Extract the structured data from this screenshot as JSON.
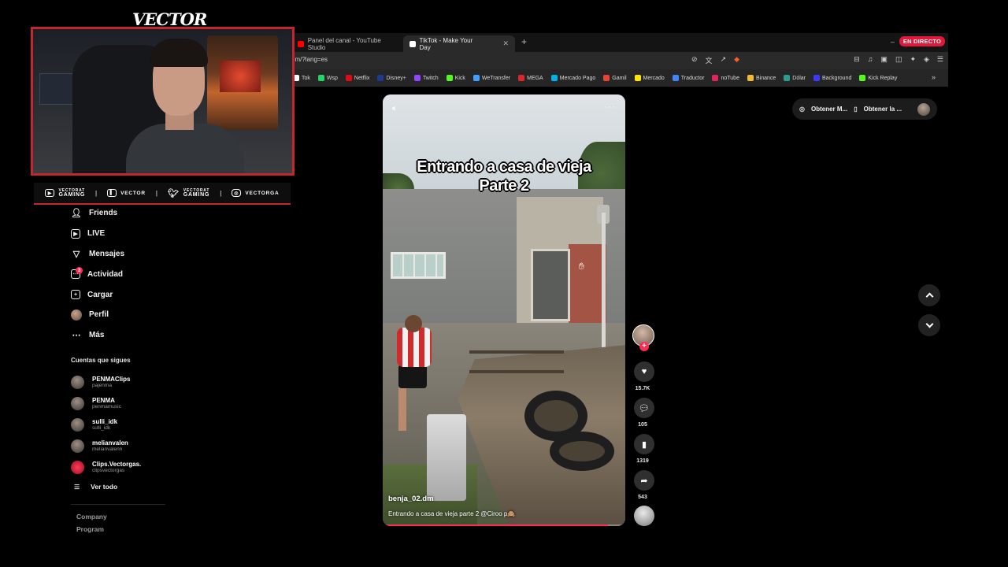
{
  "brand": "VECTOR",
  "browser": {
    "tabs": [
      {
        "label": "Panel del canal - YouTube Studio",
        "color": "#ff0000"
      },
      {
        "label": "TikTok - Make Your Day",
        "color": "#ffffff",
        "active": true
      }
    ],
    "new_tab": "+",
    "live_badge": "EN DIRECTO",
    "minimize": "–",
    "url": "om/?lang=es",
    "bookmarks": [
      {
        "label": "Tok",
        "color": "#ffffff"
      },
      {
        "label": "Wsp",
        "color": "#25d366"
      },
      {
        "label": "Netflix",
        "color": "#e50914"
      },
      {
        "label": "Disney+",
        "color": "#1f3a93"
      },
      {
        "label": "Twitch",
        "color": "#9146ff"
      },
      {
        "label": "Kick",
        "color": "#53fc18"
      },
      {
        "label": "WeTransfer",
        "color": "#409fff"
      },
      {
        "label": "MEGA",
        "color": "#d9272e"
      },
      {
        "label": "Mercado Pago",
        "color": "#00b1ea"
      },
      {
        "label": "Gamil",
        "color": "#ea4335"
      },
      {
        "label": "Mercado",
        "color": "#ffe600"
      },
      {
        "label": "Traductor",
        "color": "#4285f4"
      },
      {
        "label": "noTube",
        "color": "#e0245e"
      },
      {
        "label": "Binance",
        "color": "#f3ba2f"
      },
      {
        "label": "Dólar",
        "color": "#2a9d8f"
      },
      {
        "label": "Background",
        "color": "#3a3aff"
      },
      {
        "label": "Kick Replay",
        "color": "#53fc18"
      }
    ],
    "bookmarks_more": "»"
  },
  "social": [
    {
      "icon": "youtube-icon",
      "top": "VECTORAT",
      "bottom": "GAMING"
    },
    {
      "icon": "twitch-icon",
      "label": "VECTOR"
    },
    {
      "icon": "twitter-icon",
      "top": "VECTORAT",
      "bottom": "GAMING"
    },
    {
      "icon": "instagram-icon",
      "label": "VECTORGA"
    }
  ],
  "sidebar": {
    "items": [
      {
        "label": "Friends",
        "icon": "friends-icon"
      },
      {
        "label": "LIVE",
        "icon": "live-icon"
      },
      {
        "label": "Mensajes",
        "icon": "messages-icon"
      },
      {
        "label": "Actividad",
        "icon": "activity-icon",
        "badge": "3"
      },
      {
        "label": "Cargar",
        "icon": "upload-icon"
      },
      {
        "label": "Perfil",
        "icon": "profile-avatar"
      },
      {
        "label": "Más",
        "icon": "more-icon"
      }
    ],
    "following_title": "Cuentas que sigues",
    "following": [
      {
        "name": "PENMAClips",
        "handle": "pajenma"
      },
      {
        "name": "PENMA",
        "handle": "penmamusic"
      },
      {
        "name": "sulli_idk",
        "handle": "sulli_idk"
      },
      {
        "name": "melianvalen",
        "handle": "melianvalenn"
      },
      {
        "name": "Clips.Vectorgas.",
        "handle": "clipsvectorgas"
      }
    ],
    "see_all": "Ver todo",
    "footer": [
      "Company",
      "Program"
    ]
  },
  "video": {
    "overlay_title_1": "Entrando a casa de vieja",
    "overlay_title_2": "Parte 2",
    "author": "benja_02.dm",
    "caption": "Entrando a casa de vieja parte 2 @Ciroo p🙈",
    "progress": 0.93
  },
  "actions": {
    "likes": "15.7K",
    "comments": "105",
    "saves": "1319",
    "shares": "543"
  },
  "topright": {
    "btn1": "Obtener M...",
    "btn2": "Obtener la ..."
  }
}
